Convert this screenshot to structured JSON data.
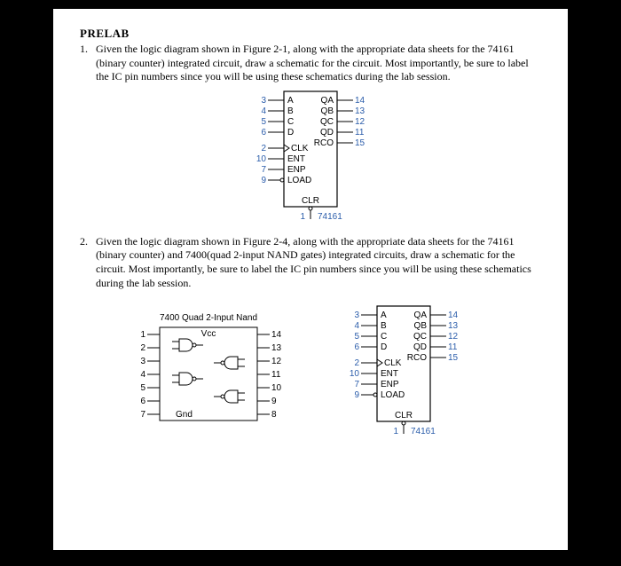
{
  "title": "PRELAB",
  "q1": {
    "num": "1.",
    "text": "Given the logic diagram shown in Figure 2-1, along with the appropriate data sheets for the 74161 (binary counter) integrated circuit, draw a schematic for the circuit. Most importantly, be sure to label the IC pin numbers since you will be using these schematics during the lab session."
  },
  "q2": {
    "num": "2.",
    "text": "Given the logic diagram shown in Figure 2-4, along with the appropriate data sheets for the 74161 (binary counter) and 7400(quad 2-input NAND gates) integrated circuits, draw a schematic for the circuit. Most importantly, be sure to label the IC pin numbers since you will be using these schematics during the lab session."
  },
  "ic74161": {
    "part": "74161",
    "left": [
      {
        "pin": "3",
        "label": "A"
      },
      {
        "pin": "4",
        "label": "B"
      },
      {
        "pin": "5",
        "label": "C"
      },
      {
        "pin": "6",
        "label": "D"
      },
      {
        "pin": "2",
        "label": "CLK",
        "clk": true
      },
      {
        "pin": "10",
        "label": "ENT"
      },
      {
        "pin": "7",
        "label": "ENP"
      },
      {
        "pin": "9",
        "label": "LOAD",
        "bubble": true
      },
      {
        "pin": "1",
        "label": "CLR",
        "bubble": true,
        "bottom": true
      }
    ],
    "right": [
      {
        "pin": "14",
        "label": "QA"
      },
      {
        "pin": "13",
        "label": "QB"
      },
      {
        "pin": "12",
        "label": "QC"
      },
      {
        "pin": "11",
        "label": "QD"
      },
      {
        "pin": "15",
        "label": "RCO"
      }
    ]
  },
  "ic7400": {
    "title": "7400 Quad 2-Input Nand",
    "vcc": "Vcc",
    "gnd": "Gnd",
    "leftpins": [
      "1",
      "2",
      "3",
      "4",
      "5",
      "6",
      "7"
    ],
    "rightpins": [
      "14",
      "13",
      "12",
      "11",
      "10",
      "9",
      "8"
    ]
  }
}
